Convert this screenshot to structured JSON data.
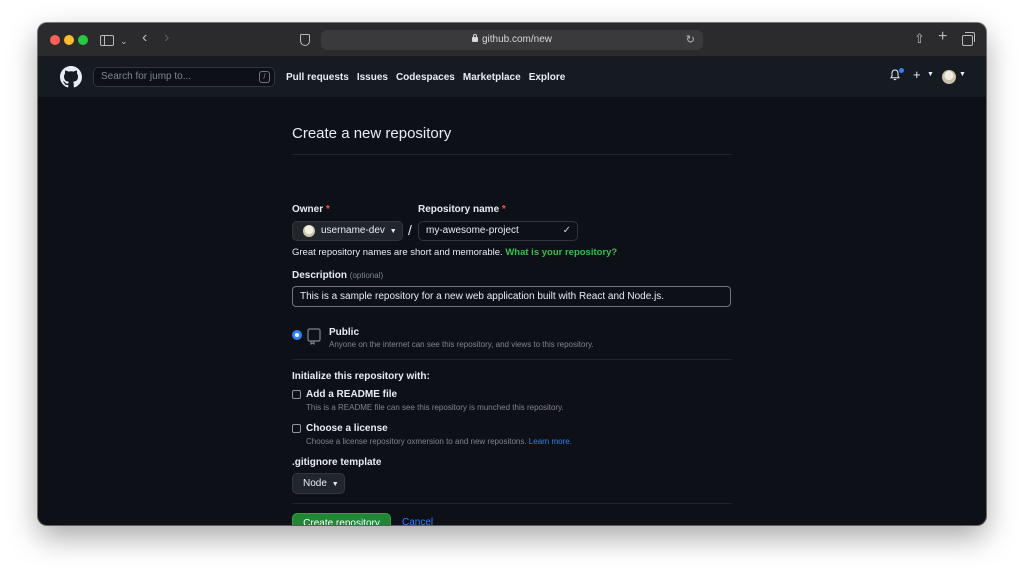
{
  "browser": {
    "url": "github.com/new"
  },
  "header": {
    "search_placeholder": "Search for jump to...",
    "search_shortcut": "/",
    "nav": [
      "Pull requests",
      "Issues",
      "Codespaces",
      "Marketplace",
      "Explore"
    ],
    "plus": "+"
  },
  "form": {
    "title": "Create a new repository",
    "owner_label": "Owner",
    "required_mark": "*",
    "owner_value": "username-dev",
    "separator": "/",
    "repo_label": "Repository name",
    "repo_value": "my-awesome-project",
    "hint_text": "Great repository names are short and memorable.",
    "hint_link": "What is your repository?",
    "description_label": "Description",
    "description_optional": "(optional)",
    "description_value": "This is a sample repository for a new web application built with React and Node.js.",
    "visibility_title": "Public",
    "visibility_desc": "Anyone on the internet can see this repository, and views to this repository.",
    "init_heading": "Initialize this repository with:",
    "readme_title": "Add a README file",
    "readme_desc": "This is a README file can see this repository is munched this repository.",
    "license_title": "Choose a license",
    "license_desc": "Choose a license repository oxmersion to and new repositons.",
    "license_link": "Learn more.",
    "gitignore_label": ".gitignore template",
    "gitignore_value": "Node",
    "create_button": "Create repository",
    "cancel_button": "Cancel"
  },
  "colors": {
    "accent_blue": "#2f81f7",
    "success_green": "#238636",
    "link_green": "#3fb950",
    "required_red": "#f85149",
    "background": "#0d1117"
  }
}
